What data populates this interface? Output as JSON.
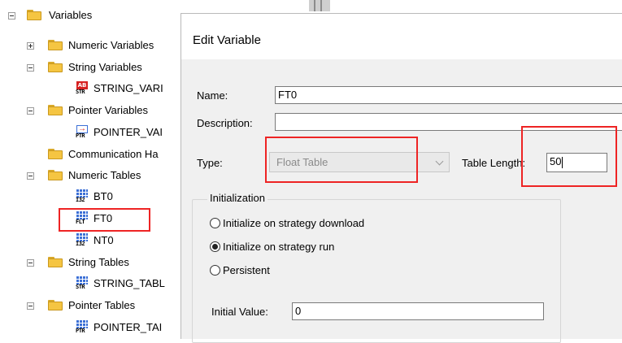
{
  "tree": {
    "root": "Variables",
    "items": [
      {
        "label": "Numeric Variables"
      },
      {
        "label": "String Variables"
      },
      {
        "label": "STRING_VARI"
      },
      {
        "label": "Pointer Variables"
      },
      {
        "label": "POINTER_VAI"
      },
      {
        "label": "Communication Ha"
      },
      {
        "label": "Numeric Tables"
      },
      {
        "label": "BT0"
      },
      {
        "label": "FT0"
      },
      {
        "label": "NT0"
      },
      {
        "label": "String Tables"
      },
      {
        "label": "STRING_TABL"
      },
      {
        "label": "Pointer Tables"
      },
      {
        "label": "POINTER_TAI"
      }
    ],
    "icon_captions": {
      "i32": "I32",
      "flt": "FLT",
      "str": "STR",
      "ptr": "PTR",
      "ab": "AB"
    }
  },
  "dialog": {
    "title": "Edit Variable",
    "name_label": "Name:",
    "name_value": "FT0",
    "description_label": "Description:",
    "description_value": "",
    "type_label": "Type:",
    "type_value": "Float Table",
    "table_length_label": "Table Length:",
    "table_length_value": "50",
    "initialization": {
      "title": "Initialization",
      "options": [
        {
          "label": "Initialize on strategy download",
          "selected": false
        },
        {
          "label": "Initialize on strategy run",
          "selected": true
        },
        {
          "label": "Persistent",
          "selected": false
        }
      ],
      "initial_value_label": "Initial Value:",
      "initial_value": "0"
    }
  },
  "colors": {
    "highlight": "#ee2424",
    "folder": "#f5c542",
    "table_icon": "#3b6fd6"
  }
}
